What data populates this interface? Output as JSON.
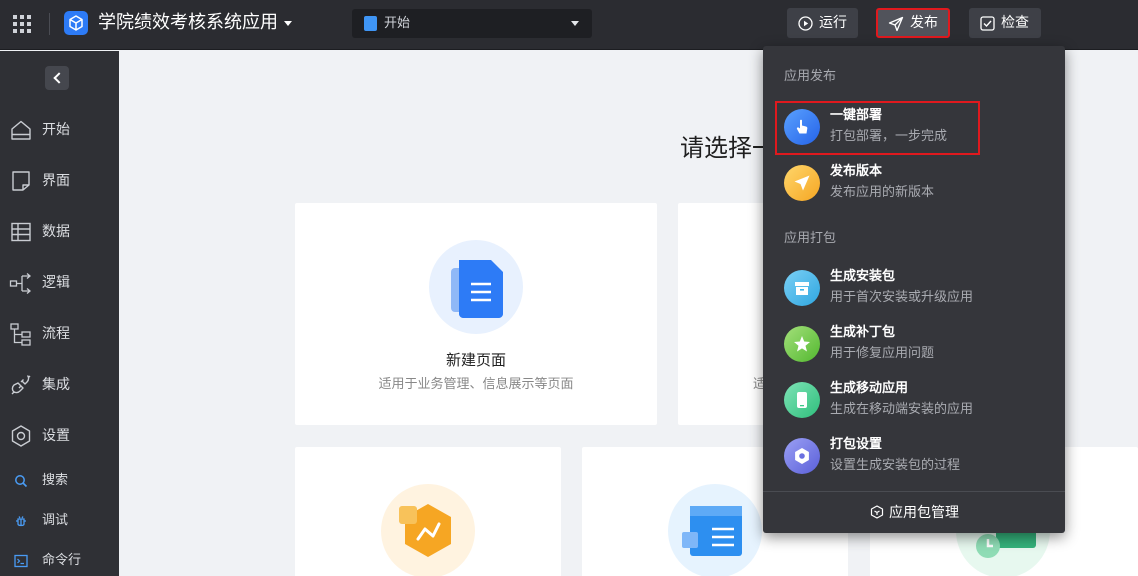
{
  "topbar": {
    "app_title": "学院绩效考核系统应用",
    "page_select_value": "开始",
    "run_label": "运行",
    "publish_label": "发布",
    "check_label": "检查"
  },
  "sidebar": {
    "items": [
      {
        "label": "开始",
        "icon": "home-icon"
      },
      {
        "label": "界面",
        "icon": "page-icon"
      },
      {
        "label": "数据",
        "icon": "table-icon"
      },
      {
        "label": "逻辑",
        "icon": "logic-icon"
      },
      {
        "label": "流程",
        "icon": "flow-icon"
      },
      {
        "label": "集成",
        "icon": "plug-icon"
      },
      {
        "label": "设置",
        "icon": "settings-icon"
      }
    ],
    "small_items": [
      {
        "label": "搜索",
        "icon": "search-icon"
      },
      {
        "label": "调试",
        "icon": "debug-icon"
      },
      {
        "label": "命令行",
        "icon": "terminal-icon"
      }
    ]
  },
  "main": {
    "title": "请选择一",
    "cards": [
      {
        "title": "新建页面",
        "desc": "适用于业务管理、信息展示等页面"
      },
      {
        "desc_partial": "适"
      }
    ]
  },
  "publish_menu": {
    "section_publish": "应用发布",
    "section_package": "应用打包",
    "items": [
      {
        "title": "一键部署",
        "desc": "打包部署，一步完成",
        "icon": "hand-tap-icon",
        "color": "#2f7bf3"
      },
      {
        "title": "发布版本",
        "desc": "发布应用的新版本",
        "icon": "paper-plane-icon",
        "color": "#f8b531"
      },
      {
        "title": "生成安装包",
        "desc": "用于首次安装或升级应用",
        "icon": "package-box-icon",
        "color": "#3bb5e8"
      },
      {
        "title": "生成补丁包",
        "desc": "用于修复应用问题",
        "icon": "patch-icon",
        "color": "#6cc43f"
      },
      {
        "title": "生成移动应用",
        "desc": "生成在移动端安装的应用",
        "icon": "mobile-icon",
        "color": "#3ec98a"
      },
      {
        "title": "打包设置",
        "desc": "设置生成安装包的过程",
        "icon": "gear-icon",
        "color": "#6b70e0"
      }
    ],
    "footer_label": "应用包管理"
  }
}
